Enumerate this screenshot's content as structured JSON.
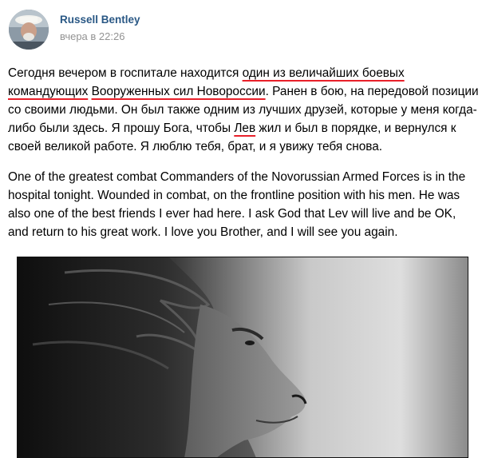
{
  "post": {
    "author": "Russell Bentley",
    "time": "вчера в 22:26",
    "text_ru": {
      "p1": "Сегодня вечером в госпитале находится ",
      "h1": "один из величайших боевых командующих",
      "p2": " ",
      "h2": "Вооруженных сил Новороссии",
      "p3": ". Ранен в бою, на передовой позиции со своими людьми. Он был также одним из лучших друзей, которые у меня когда-либо были здесь. Я прошу Бога, чтобы ",
      "h3": "Лев",
      "p4": " жил и был в порядке, и вернулся к своей великой работе. Я люблю тебя, брат, и я увижу тебя снова."
    },
    "text_en": "One of the greatest combat Commanders of the Novorussian Armed Forces is in the hospital tonight. Wounded in combat, on the frontline position with his men. He was also one of the best friends I ever had here. I ask God that Lev will live and be OK, and return to his great work. I love you Brother, and I will see you again."
  },
  "colors": {
    "author_link": "#2a5885",
    "timestamp": "#939393",
    "highlight_underline": "#e8202a"
  }
}
